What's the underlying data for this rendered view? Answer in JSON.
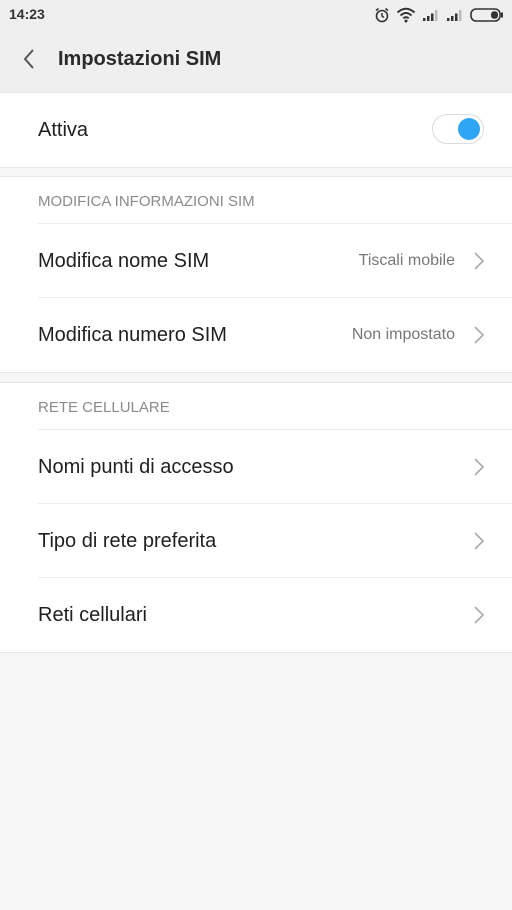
{
  "status_bar": {
    "time": "14:23",
    "icons": [
      "alarm-icon",
      "wifi-icon",
      "signal-icon",
      "signal-icon",
      "battery-icon"
    ]
  },
  "header": {
    "back_icon": "chevron-left-icon",
    "title": "Impostazioni SIM"
  },
  "active_card": {
    "label": "Attiva",
    "toggle_on": true,
    "accent_color": "#2fa6f5"
  },
  "sim_info_section": {
    "header": "MODIFICA INFORMAZIONI SIM",
    "items": [
      {
        "label": "Modifica nome SIM",
        "value": "Tiscali mobile"
      },
      {
        "label": "Modifica numero SIM",
        "value": "Non impostato"
      }
    ]
  },
  "network_section": {
    "header": "RETE CELLULARE",
    "items": [
      {
        "label": "Nomi punti di accesso"
      },
      {
        "label": "Tipo di rete preferita"
      },
      {
        "label": "Reti cellulari"
      }
    ]
  }
}
